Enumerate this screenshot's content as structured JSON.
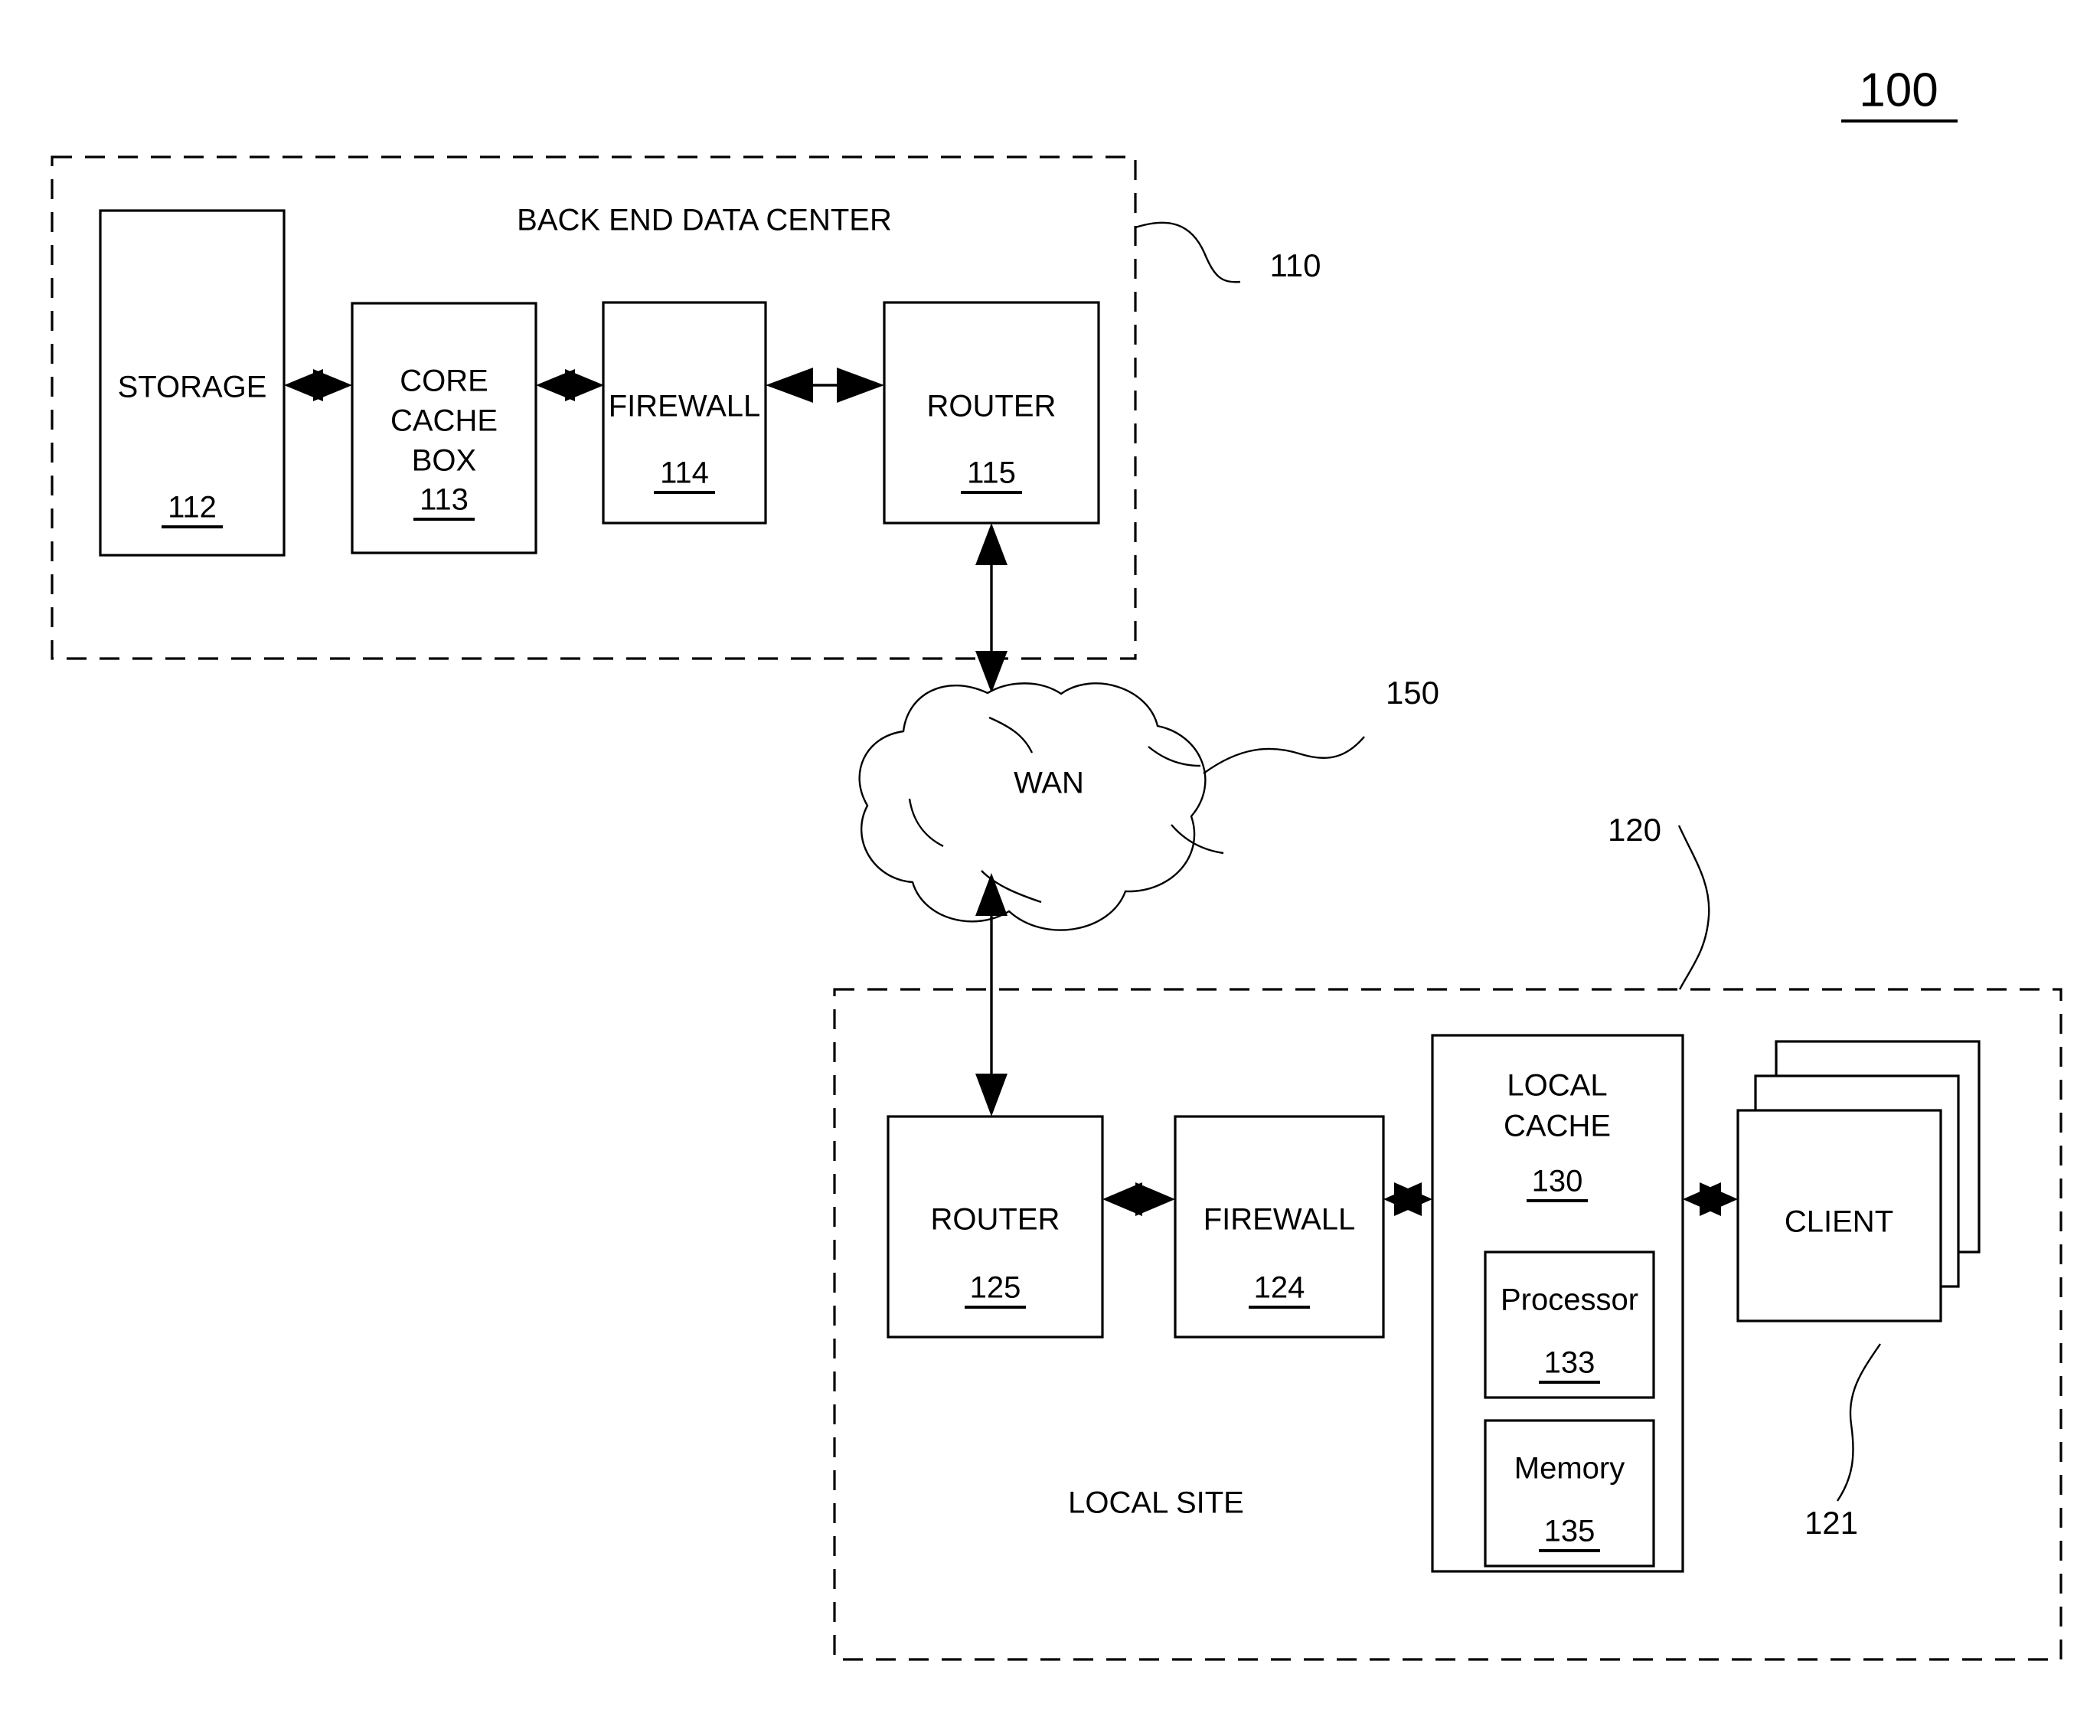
{
  "figure": {
    "number": "100",
    "underlined": true
  },
  "regions": [
    {
      "id": "back-end-data-center",
      "label": "BACK END DATA CENTER",
      "ref": "110"
    },
    {
      "id": "local-site",
      "label": "LOCAL SITE",
      "ref": "120"
    }
  ],
  "nodes": {
    "storage": {
      "label": "STORAGE",
      "ref": "112"
    },
    "core_cache_box": {
      "line1": "CORE",
      "line2": "CACHE",
      "line3": "BOX",
      "ref": "113"
    },
    "firewall_backend": {
      "label": "FIREWALL",
      "ref": "114"
    },
    "router_backend": {
      "label": "ROUTER",
      "ref": "115"
    },
    "wan": {
      "label": "WAN",
      "ref": "150"
    },
    "router_local": {
      "label": "ROUTER",
      "ref": "125"
    },
    "firewall_local": {
      "label": "FIREWALL",
      "ref": "124"
    },
    "local_cache": {
      "line1": "LOCAL",
      "line2": "CACHE",
      "ref": "130"
    },
    "processor": {
      "label": "Processor",
      "ref": "133"
    },
    "memory": {
      "label": "Memory",
      "ref": "135"
    },
    "client": {
      "label": "CLIENT",
      "ref": "121"
    }
  },
  "connections": [
    {
      "from": "storage",
      "to": "core_cache_box",
      "style": "bidirectional"
    },
    {
      "from": "core_cache_box",
      "to": "firewall_backend",
      "style": "bidirectional"
    },
    {
      "from": "firewall_backend",
      "to": "router_backend",
      "style": "bidirectional"
    },
    {
      "from": "router_backend",
      "to": "wan",
      "style": "bidirectional"
    },
    {
      "from": "wan",
      "to": "router_local",
      "style": "bidirectional"
    },
    {
      "from": "router_local",
      "to": "firewall_local",
      "style": "bidirectional"
    },
    {
      "from": "firewall_local",
      "to": "local_cache",
      "style": "bidirectional"
    },
    {
      "from": "local_cache",
      "to": "client",
      "style": "bidirectional"
    }
  ],
  "colors": {
    "stroke": "#000000",
    "background": "#ffffff"
  }
}
